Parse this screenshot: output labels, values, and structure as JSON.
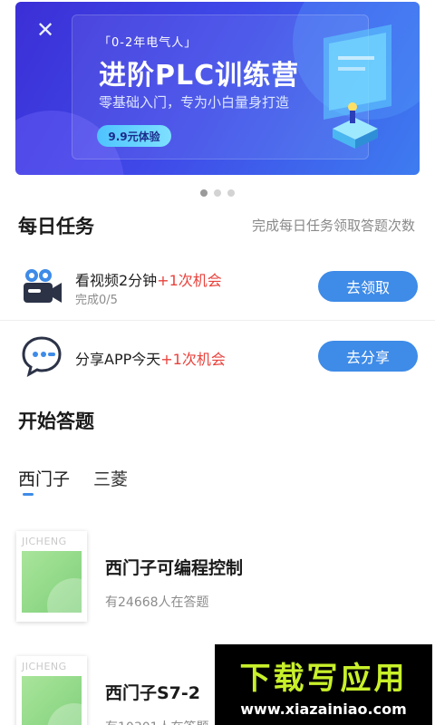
{
  "banner": {
    "tag": "「0-2年电气人」",
    "title": "进阶PLC训练营",
    "subtitle": "零基础入门，专为小白量身打造",
    "pill": "9.9元体验",
    "close_icon": "close-icon",
    "colors": {
      "start": "#3b2fd6",
      "end": "#3e7cf0"
    }
  },
  "carousel": {
    "pages": 3,
    "active": 0
  },
  "daily": {
    "title": "每日任务",
    "hint": "完成每日任务领取答题次数",
    "tasks": [
      {
        "text": "看视频2分钟",
        "highlight": "+1次机会",
        "progress": "完成0/5",
        "button": "去领取",
        "icon": "video-camera-icon"
      },
      {
        "text": "分享APP今天",
        "highlight": "+1次机会",
        "button": "去分享",
        "icon": "chat-bubble-icon"
      }
    ]
  },
  "quiz_section": {
    "title": "开始答题",
    "tabs": [
      {
        "label": "西门子",
        "active": true
      },
      {
        "label": "三菱",
        "active": false
      }
    ],
    "items": [
      {
        "brand": "JICHENG",
        "title": "西门子可编程控制",
        "sub": "有24668人在答题"
      },
      {
        "brand": "JICHENG",
        "title": "西门子S7-2",
        "sub": "有10301人在答题"
      }
    ]
  },
  "watermark": {
    "title": "下载写应用",
    "url": "www.xiazainiao.com"
  },
  "colors": {
    "accent": "#3e8be8",
    "highlight": "#e8423c",
    "muted": "#8c8c8c"
  }
}
